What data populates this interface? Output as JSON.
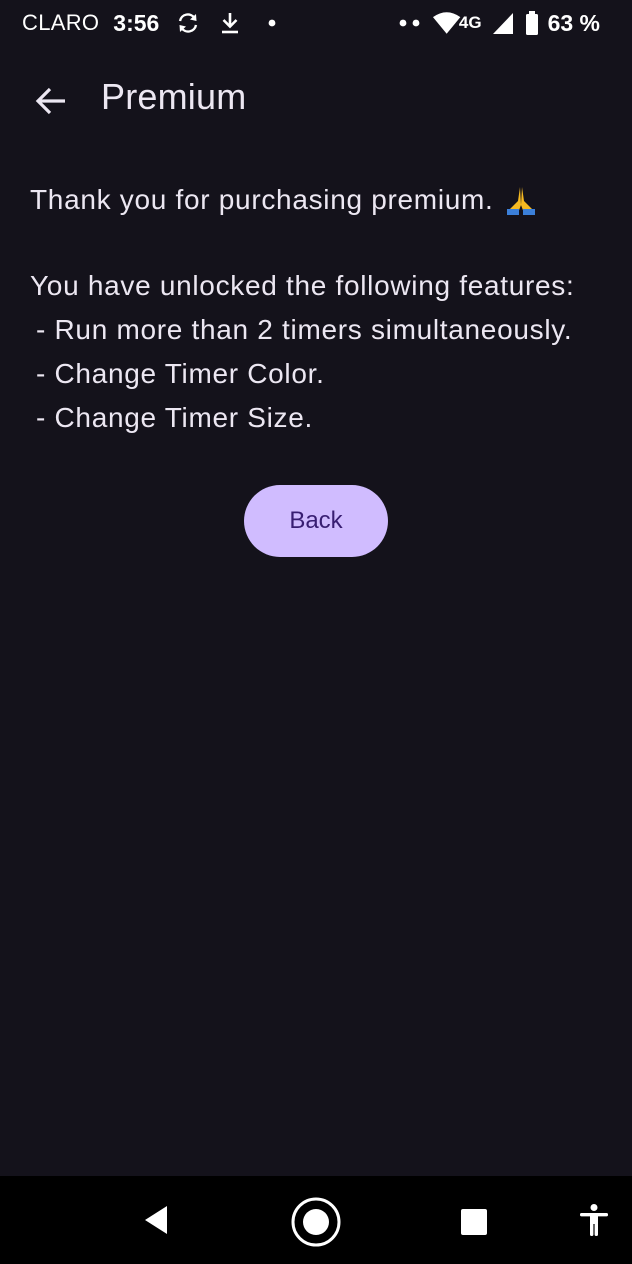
{
  "status_bar": {
    "carrier": "CLARO",
    "time": "3:56",
    "network": "4G",
    "battery": "63 %",
    "icons": [
      "sync-icon",
      "download-icon",
      "dot-icon",
      "two-dots-icon",
      "wifi-icon",
      "signal-icon",
      "battery-icon"
    ]
  },
  "app_bar": {
    "title": "Premium",
    "back_icon": "arrow-left-icon"
  },
  "content": {
    "thanks": "Thank you for purchasing premium.",
    "thanks_emoji": "folded-hands-icon",
    "features_intro": "You have unlocked the following features:",
    "features": [
      "- Run more than 2 timers simultaneously.",
      "- Change Timer Color.",
      "- Change Timer Size."
    ]
  },
  "back_button": {
    "label": "Back",
    "bg_color": "#d0bcff",
    "text_color": "#381e72"
  },
  "colors": {
    "background": "#14121b",
    "text": "#ece7f2"
  },
  "nav_bar": {
    "items": [
      "nav-back-icon",
      "nav-home-icon",
      "nav-recents-icon",
      "accessibility-icon"
    ]
  }
}
